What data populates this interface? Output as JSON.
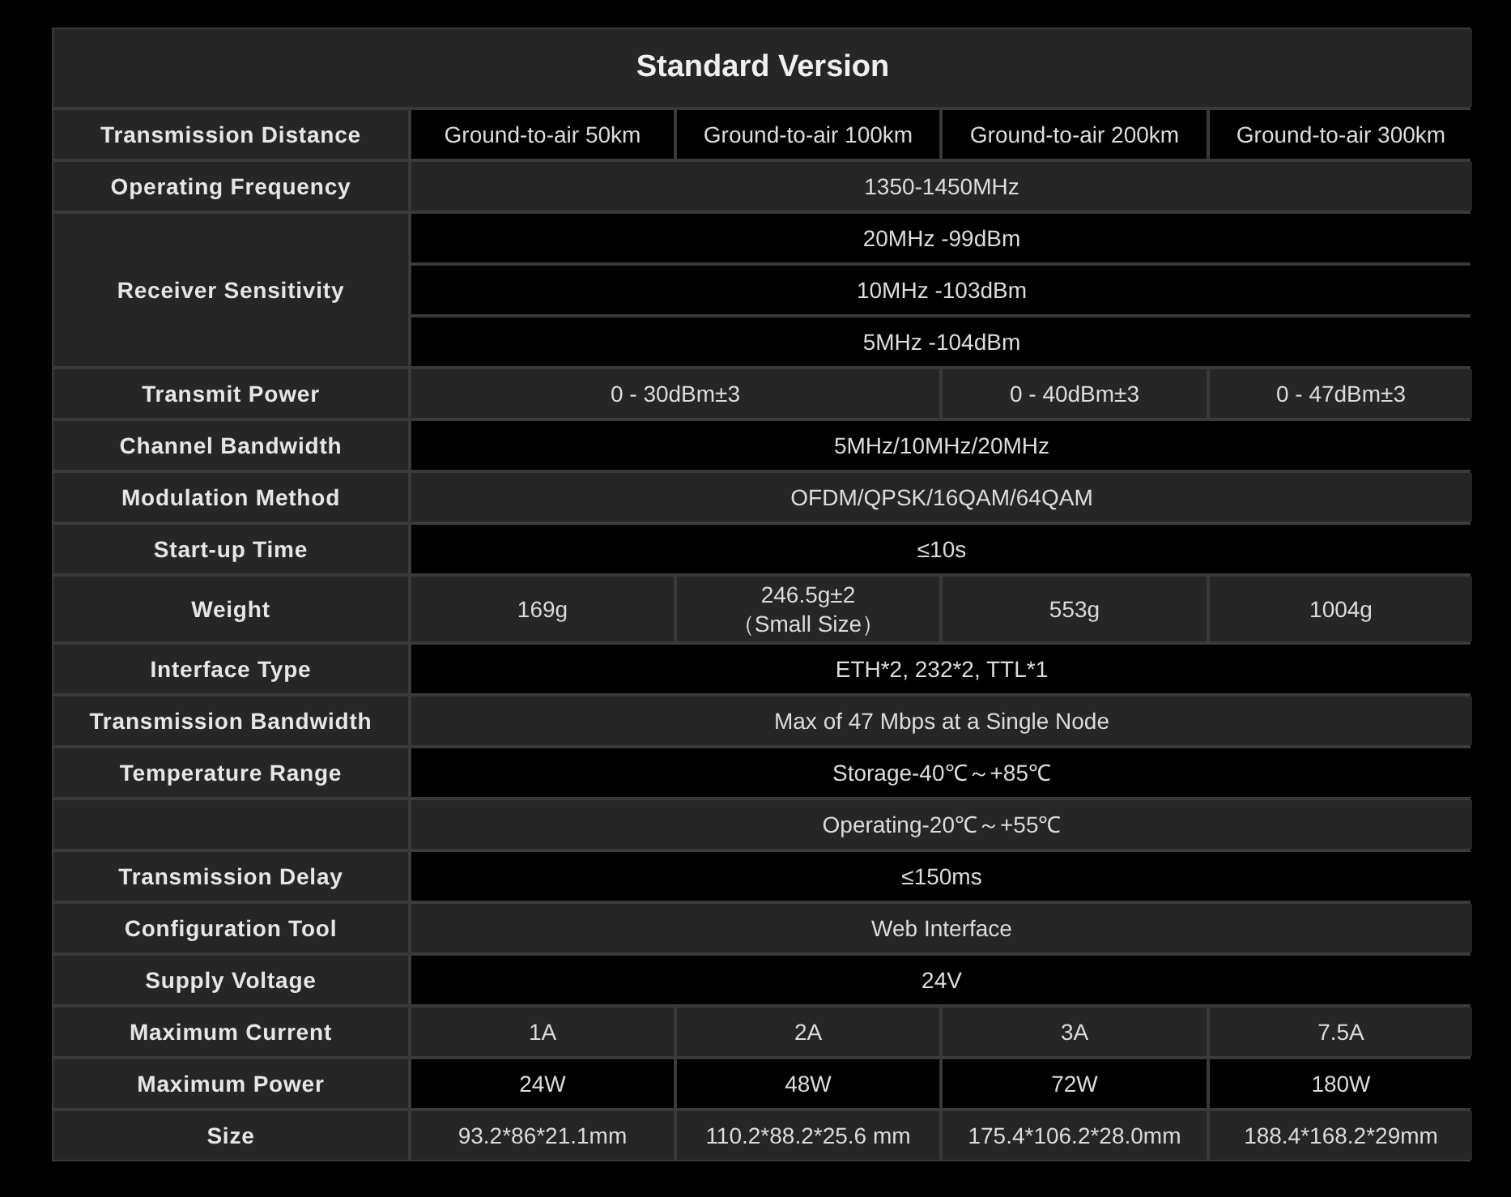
{
  "title": "Standard Version",
  "rows": [
    {
      "label": "Transmission Distance",
      "lines": [
        {
          "color": "#000000",
          "cells": [
            {
              "text": "Ground-to-air 50km",
              "kind": "single"
            },
            {
              "text": "Ground-to-air 100km",
              "kind": "single"
            },
            {
              "text": "Ground-to-air 200km",
              "kind": "single"
            },
            {
              "text": "Ground-to-air 300km",
              "kind": "single"
            }
          ]
        }
      ]
    },
    {
      "label": "Operating Frequency",
      "lines": [
        {
          "color": "#262626",
          "cells": [
            {
              "text": "1350-1450MHz",
              "kind": "full"
            }
          ]
        }
      ]
    },
    {
      "label": "Receiver Sensitivity",
      "lines": [
        {
          "color": "#000000",
          "cells": [
            {
              "text": "20MHz  -99dBm",
              "kind": "full"
            }
          ]
        },
        {
          "color": "#000000",
          "cells": [
            {
              "text": "10MHz  -103dBm",
              "kind": "full"
            }
          ]
        },
        {
          "color": "#000000",
          "cells": [
            {
              "text": "5MHz  -104dBm",
              "kind": "full"
            }
          ]
        }
      ]
    },
    {
      "label": "Transmit Power",
      "lines": [
        {
          "color": "#262626",
          "cells": [
            {
              "text": "0 - 30dBm±3",
              "kind": "double"
            },
            {
              "text": "0 - 40dBm±3",
              "kind": "single"
            },
            {
              "text": "0 - 47dBm±3",
              "kind": "single"
            }
          ]
        }
      ]
    },
    {
      "label": "Channel Bandwidth",
      "lines": [
        {
          "color": "#000000",
          "cells": [
            {
              "text": "5MHz/10MHz/20MHz",
              "kind": "full"
            }
          ]
        }
      ]
    },
    {
      "label": "Modulation Method",
      "lines": [
        {
          "color": "#262626",
          "cells": [
            {
              "text": "OFDM/QPSK/16QAM/64QAM",
              "kind": "full"
            }
          ]
        }
      ]
    },
    {
      "label": "Start-up Time",
      "lines": [
        {
          "color": "#000000",
          "cells": [
            {
              "text": "≤10s",
              "kind": "full"
            }
          ]
        }
      ]
    },
    {
      "label": "Weight",
      "lines": [
        {
          "color": "#262626",
          "cells": [
            {
              "text": "169g",
              "kind": "single"
            },
            {
              "text": "246.5g±2\n（Small Size）",
              "kind": "single"
            },
            {
              "text": "553g",
              "kind": "single"
            },
            {
              "text": "1004g",
              "kind": "single"
            }
          ]
        }
      ]
    },
    {
      "label": "Interface Type",
      "lines": [
        {
          "color": "#000000",
          "cells": [
            {
              "text": "ETH*2, 232*2, TTL*1",
              "kind": "full"
            }
          ]
        }
      ]
    },
    {
      "label": "Transmission Bandwidth",
      "lines": [
        {
          "color": "#262626",
          "cells": [
            {
              "text": "Max of 47 Mbps at a Single Node",
              "kind": "full"
            }
          ]
        }
      ]
    },
    {
      "label": "Temperature Range",
      "lines": [
        {
          "color": "#000000",
          "cells": [
            {
              "text": "Storage-40℃～+85℃",
              "kind": "full"
            }
          ]
        }
      ]
    },
    {
      "lines": [
        {
          "color": "#262626",
          "cells": [
            {
              "text": "Operating-20℃～+55℃",
              "kind": "full"
            }
          ]
        }
      ]
    },
    {
      "label": "Transmission Delay",
      "lines": [
        {
          "color": "#000000",
          "cells": [
            {
              "text": "≤150ms",
              "kind": "full"
            }
          ]
        }
      ]
    },
    {
      "label": "Configuration Tool",
      "lines": [
        {
          "color": "#262626",
          "cells": [
            {
              "text": "Web Interface",
              "kind": "full"
            }
          ]
        }
      ]
    },
    {
      "label": "Supply Voltage",
      "lines": [
        {
          "color": "#000000",
          "cells": [
            {
              "text": "24V",
              "kind": "full"
            }
          ]
        }
      ]
    },
    {
      "label": "Maximum Current",
      "lines": [
        {
          "color": "#262626",
          "cells": [
            {
              "text": "1A",
              "kind": "single"
            },
            {
              "text": "2A",
              "kind": "single"
            },
            {
              "text": "3A",
              "kind": "single"
            },
            {
              "text": "7.5A",
              "kind": "single"
            }
          ]
        }
      ]
    },
    {
      "label": "Maximum Power",
      "lines": [
        {
          "color": "#000000",
          "cells": [
            {
              "text": "24W",
              "kind": "single"
            },
            {
              "text": "48W",
              "kind": "single"
            },
            {
              "text": "72W",
              "kind": "single"
            },
            {
              "text": "180W",
              "kind": "single"
            }
          ]
        }
      ]
    },
    {
      "label": "Size",
      "lines": [
        {
          "color": "#262626",
          "cells": [
            {
              "text": "93.2*86*21.1mm",
              "kind": "single"
            },
            {
              "text": "110.2*88.2*25.6 mm",
              "kind": "single"
            },
            {
              "text": "175.4*106.2*28.0mm",
              "kind": "single"
            },
            {
              "text": "188.4*168.2*29mm",
              "kind": "single"
            }
          ]
        }
      ]
    }
  ]
}
